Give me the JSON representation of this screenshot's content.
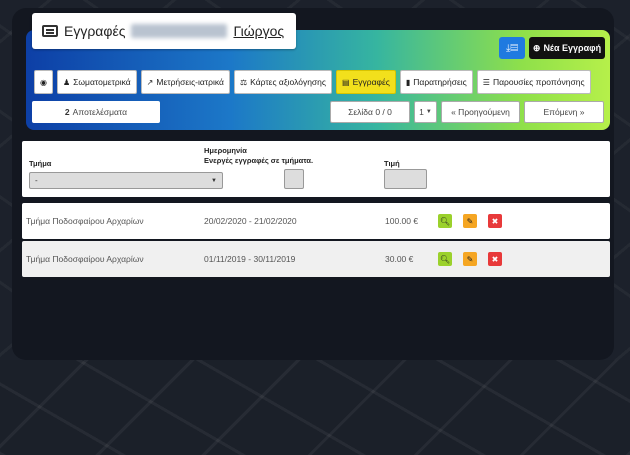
{
  "header": {
    "title_prefix": "Εγγραφές",
    "title_name": "Γιώργος",
    "new_button_label": "Νέα Εγγραφή",
    "new_button_icon": "plus-circle-icon",
    "export_button_icon": "download-icon"
  },
  "tabs": [
    {
      "label": "",
      "icon": "user-icon",
      "active": false
    },
    {
      "label": "Σωματομετρικά",
      "icon": "body-icon",
      "active": false
    },
    {
      "label": "Μετρήσεις-ιατρικά",
      "icon": "chart-icon",
      "active": false
    },
    {
      "label": "Κάρτες αξιολόγησης",
      "icon": "scale-icon",
      "active": false
    },
    {
      "label": "Εγγραφές",
      "icon": "list-icon",
      "active": true
    },
    {
      "label": "Παρατηρήσεις",
      "icon": "book-icon",
      "active": false
    },
    {
      "label": "Παρουσίες προπόνησης",
      "icon": "list-icon",
      "active": false
    }
  ],
  "results": {
    "count": "2",
    "label": "Αποτελέσματα"
  },
  "pager": {
    "page_label": "Σελίδα 0 / 0",
    "page_select": "1",
    "prev_label": "« Προηγούμενη",
    "next_label": "Επόμενη »"
  },
  "filters": {
    "department_label": "Τμήμα",
    "department_value": "-",
    "date_label": "Ημερομηνία",
    "active_label": "Ενεργές εγγραφές σε τμήματα.",
    "price_label": "Τιμή"
  },
  "rows": [
    {
      "department": "Τμήμα Ποδοσφαίρου Αρχαρίων",
      "dates": "20/02/2020 - 21/02/2020",
      "price": "100.00 €"
    },
    {
      "department": "Τμήμα Ποδοσφαίρου Αρχαρίων",
      "dates": "01/11/2019 - 30/11/2019",
      "price": "30.00 €"
    }
  ],
  "colors": {
    "active_tab": "#f2e01c",
    "view": "#9bd12c",
    "edit": "#f5a623",
    "delete": "#e8393a"
  }
}
